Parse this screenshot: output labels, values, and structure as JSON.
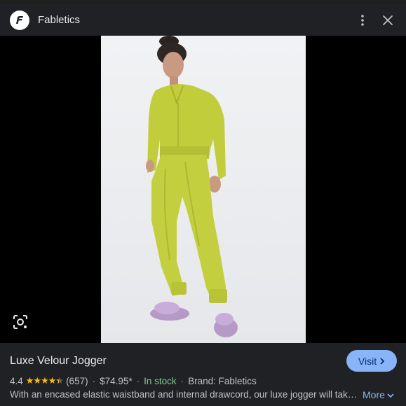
{
  "header": {
    "site_name": "Fabletics",
    "logo_icon": "fabletics-logo-icon",
    "menu_icon": "more-vert-icon",
    "close_icon": "close-icon"
  },
  "image": {
    "subject": "product-photo-woman-in-lime-velour-tracksuit",
    "lens_icon": "google-lens-icon"
  },
  "product": {
    "title": "Luxe Velour Jogger",
    "rating": "4.4",
    "stars_shown": 4.4,
    "review_count": "(657)",
    "price": "$74.95*",
    "availability": "In stock",
    "brand": "Brand: Fabletics",
    "description": "With an encased elastic waistband and internal drawcord, our luxe jogger will tak…",
    "more_label": "More",
    "visit_label": "Visit"
  },
  "colors": {
    "background": "#202124",
    "accent_button": "#8ab4f8",
    "star": "#fbbc04",
    "in_stock": "#81c995",
    "garment": "#c4cf3f"
  }
}
